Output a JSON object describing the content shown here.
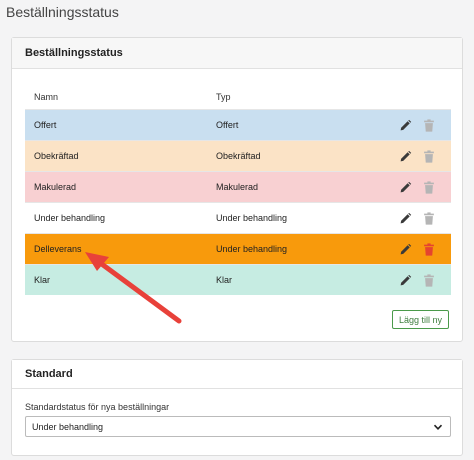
{
  "page_title": "Beställningsstatus",
  "status_card": {
    "title": "Beställningsstatus",
    "columns": {
      "name": "Namn",
      "type": "Typ"
    },
    "rows": [
      {
        "name": "Offert",
        "type": "Offert",
        "bg": "#c9dff0"
      },
      {
        "name": "Obekräftad",
        "type": "Obekräftad",
        "bg": "#fbe3c6"
      },
      {
        "name": "Makulerad",
        "type": "Makulerad",
        "bg": "#f8d0d2"
      },
      {
        "name": "Under behandling",
        "type": "Under behandling",
        "bg": "#ffffff"
      },
      {
        "name": "Delleverans",
        "type": "Under behandling",
        "bg": "#f89a0c",
        "delete_color": "#e5442f"
      },
      {
        "name": "Klar",
        "type": "Klar",
        "bg": "#c6ece2"
      }
    ],
    "add_button": "Lägg till ny"
  },
  "standard_card": {
    "title": "Standard",
    "field_label": "Standardstatus för nya beställningar",
    "selected": "Under behandling"
  },
  "colors": {
    "edit_icon": "#3a3a3a",
    "delete_icon": "#b5b5b5",
    "add_button": "#4a9a4a",
    "annotation_arrow": "#e8413a"
  },
  "icons": {
    "edit": "pencil-icon",
    "delete": "trash-icon",
    "select": "chevron-down-icon"
  }
}
